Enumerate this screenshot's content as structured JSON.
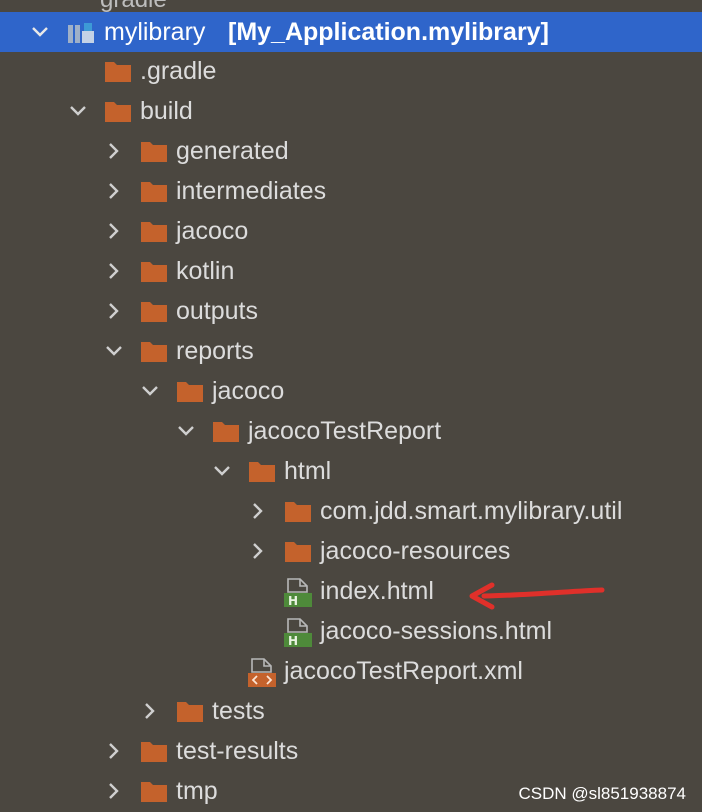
{
  "tree": {
    "top_sliver_text": "gradle",
    "module": {
      "name": "mylibrary",
      "qualified": "[My_Application.mylibrary]"
    },
    "nodes": {
      "gradle": ".gradle",
      "build": "build",
      "generated": "generated",
      "intermediates": "intermediates",
      "jacoco": "jacoco",
      "kotlin": "kotlin",
      "outputs": "outputs",
      "reports": "reports",
      "reports_jacoco": "jacoco",
      "jacocoTestReport": "jacocoTestReport",
      "html": "html",
      "util_pkg": "com.jdd.smart.mylibrary.util",
      "jacoco_resources": "jacoco-resources",
      "index_html": "index.html",
      "sessions_html": "jacoco-sessions.html",
      "report_xml": "jacocoTestReport.xml",
      "tests": "tests",
      "test_results": "test-results",
      "tmp": "tmp"
    },
    "icons": {
      "folder": "folder-icon",
      "module": "module-icon",
      "html_file": "html-file-icon",
      "xml_file": "xml-file-icon",
      "chevron_right": "chevron-right-icon",
      "chevron_down": "chevron-down-icon"
    },
    "colors": {
      "background": "#4b4740",
      "selection": "#2f65ca",
      "folder": "#c4622c",
      "html_badge": "#4e8a3a",
      "xml_badge": "#c4622c",
      "annotation_arrow": "#e0302a"
    }
  },
  "watermark": "CSDN @sl851938874"
}
